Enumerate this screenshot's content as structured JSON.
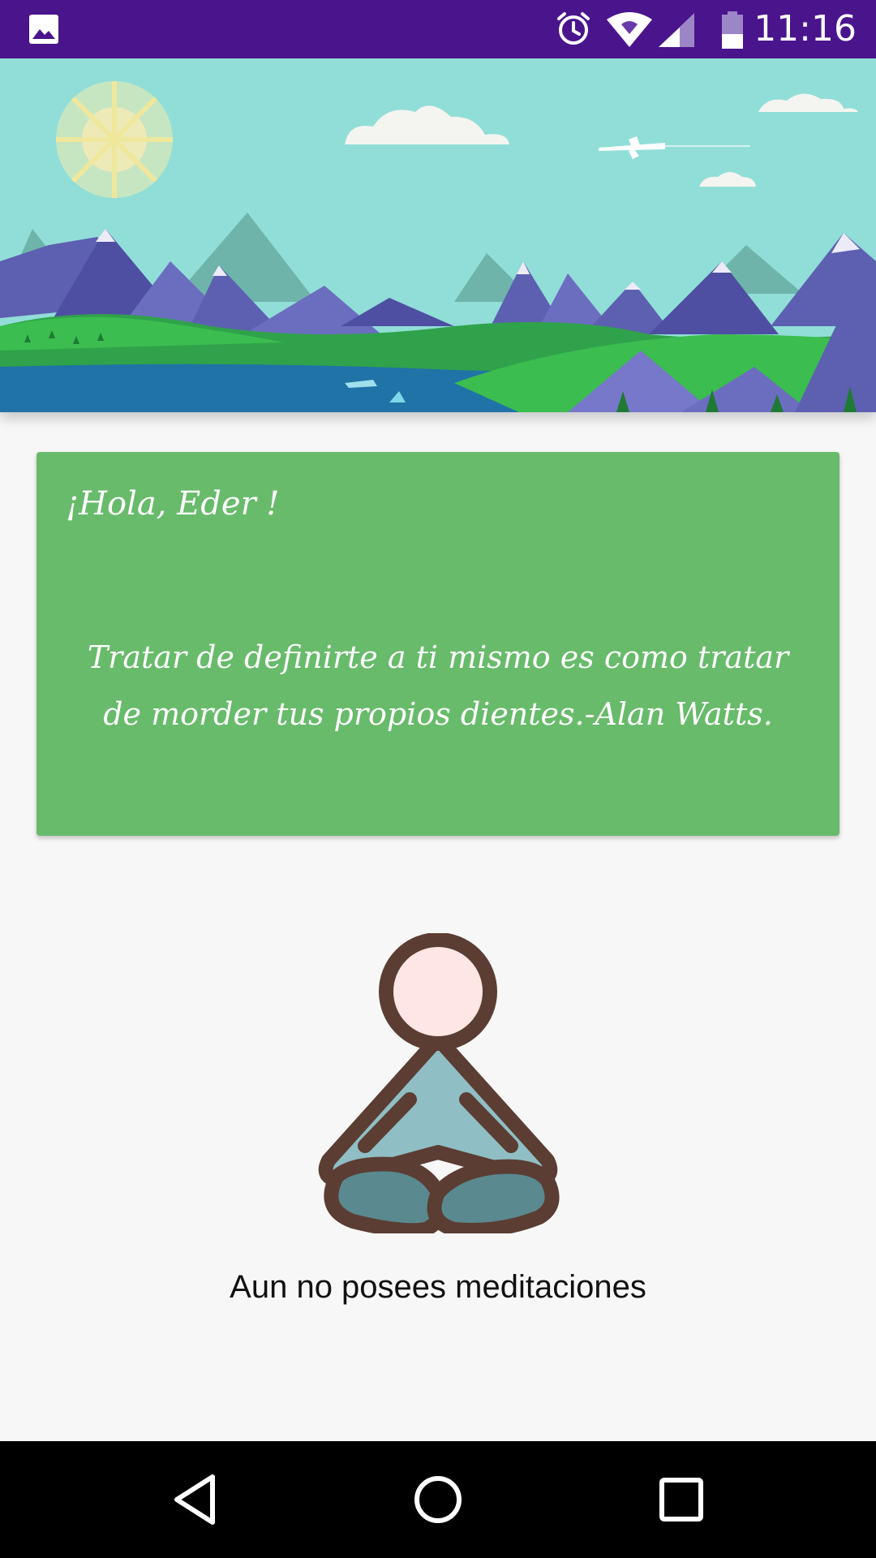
{
  "status_bar": {
    "time": "11:16",
    "background_color": "#4a148c",
    "icons": [
      "image-notification-icon",
      "alarm-icon",
      "wifi-icon",
      "cell-signal-icon",
      "battery-icon"
    ]
  },
  "header": {
    "illustration": "mountain-landscape-illustration",
    "sky_color": "#91ddd8"
  },
  "greeting_card": {
    "greeting": "¡Hola, Eder !",
    "quote": "Tratar de definirte a ti mismo es como tratar de morder tus propios dientes.-Alan Watts.",
    "background_color": "#68bb6a"
  },
  "empty_state": {
    "illustration": "meditation-person-icon",
    "message": "Aun no posees meditaciones"
  },
  "nav_bar": {
    "buttons": [
      "back-icon",
      "home-icon",
      "recents-icon"
    ]
  }
}
